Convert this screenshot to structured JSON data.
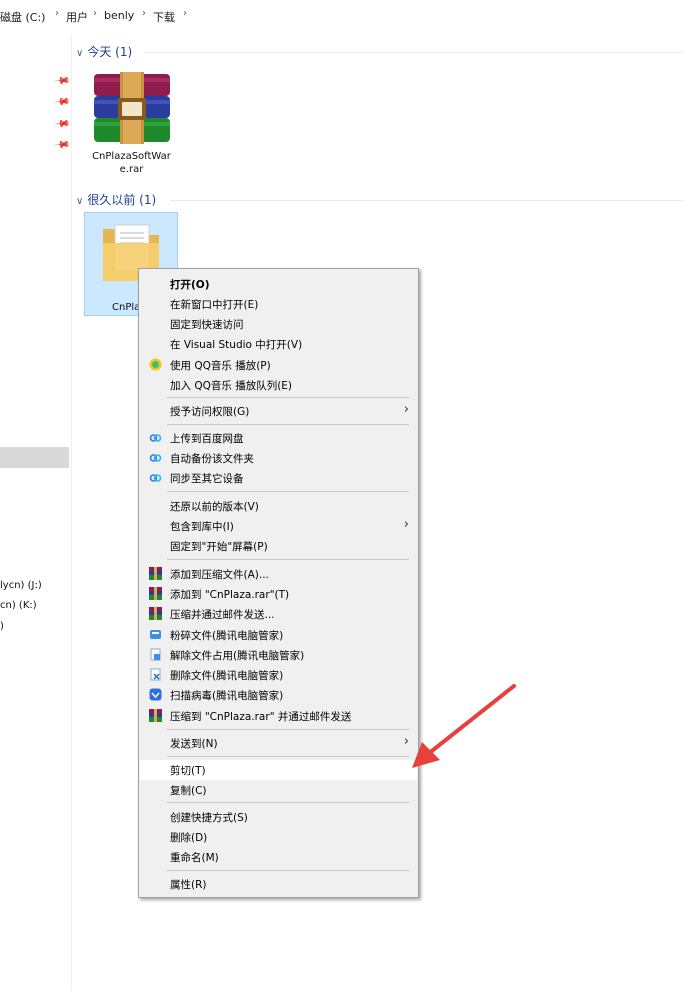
{
  "breadcrumb": {
    "items": [
      "磁盘 (C:)",
      "用户",
      "benly",
      "下载"
    ],
    "separator": "›",
    "expand": "›"
  },
  "nav": {
    "pins": [
      "📌",
      "📌",
      "📌",
      "📌"
    ],
    "drives": [
      "lycn) (J:)",
      "cn) (K:)",
      ")"
    ]
  },
  "groups": {
    "today": {
      "label": "今天 (1)"
    },
    "long_ago": {
      "label": "很久以前 (1)"
    }
  },
  "files": {
    "rar": {
      "name_line1": "CnPlazaSoftWar",
      "name_line2": "e.rar"
    },
    "folder": {
      "name": "CnPla"
    }
  },
  "menu": {
    "items": [
      {
        "label": "打开(O)",
        "bold": true
      },
      {
        "label": "在新窗口中打开(E)"
      },
      {
        "label": "固定到快速访问"
      },
      {
        "label": "在 Visual Studio 中打开(V)"
      },
      {
        "label": "使用 QQ音乐 播放(P)",
        "icon": "qq-music-icon"
      },
      {
        "label": "加入 QQ音乐 播放队列(E)"
      },
      {
        "label": "授予访问权限(G)",
        "submenu": true
      },
      {
        "label": "上传到百度网盘",
        "icon": "baidu-netdisk-icon"
      },
      {
        "label": "自动备份该文件夹",
        "icon": "baidu-netdisk-icon"
      },
      {
        "label": "同步至其它设备",
        "icon": "baidu-netdisk-icon"
      },
      {
        "label": "还原以前的版本(V)"
      },
      {
        "label": "包含到库中(I)",
        "submenu": true
      },
      {
        "label": "固定到\"开始\"屏幕(P)"
      },
      {
        "label": "添加到压缩文件(A)...",
        "icon": "winrar-icon"
      },
      {
        "label": "添加到 \"CnPlaza.rar\"(T)",
        "icon": "winrar-icon"
      },
      {
        "label": "压缩并通过邮件发送...",
        "icon": "winrar-icon"
      },
      {
        "label": "粉碎文件(腾讯电脑管家)",
        "icon": "shred-icon"
      },
      {
        "label": "解除文件占用(腾讯电脑管家)",
        "icon": "unlock-file-icon"
      },
      {
        "label": "删除文件(腾讯电脑管家)",
        "icon": "delete-file-icon"
      },
      {
        "label": "扫描病毒(腾讯电脑管家)",
        "icon": "virus-scan-icon"
      },
      {
        "label": "压缩到 \"CnPlaza.rar\" 并通过邮件发送",
        "icon": "winrar-icon"
      },
      {
        "label": "发送到(N)",
        "submenu": true
      },
      {
        "label": "剪切(T)"
      },
      {
        "label": "复制(C)"
      },
      {
        "label": "创建快捷方式(S)"
      },
      {
        "label": "删除(D)"
      },
      {
        "label": "重命名(M)"
      },
      {
        "label": "属性(R)"
      }
    ],
    "submenu_glyph": "›"
  },
  "colors": {
    "accent_arrow": "#e8403c",
    "selection_bg": "#cce8ff",
    "menu_bg": "#f0f0f0"
  }
}
